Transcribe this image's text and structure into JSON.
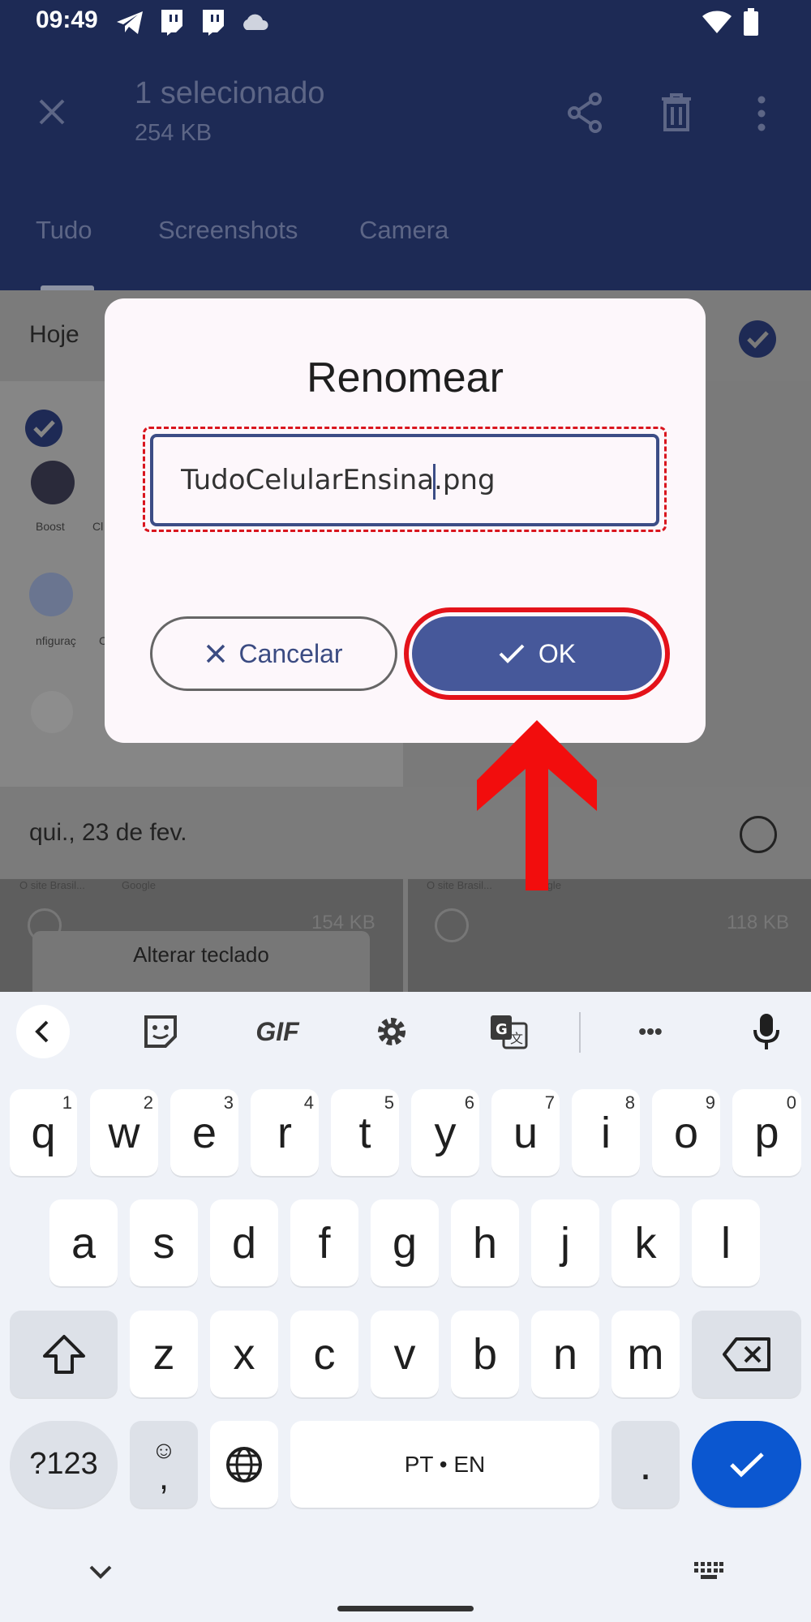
{
  "status_bar": {
    "time": "09:49"
  },
  "app_bar": {
    "title": "1 selecionado",
    "subtitle": "254 KB",
    "tabs": [
      "Tudo",
      "Screenshots",
      "Camera"
    ]
  },
  "background": {
    "section_today": "Hoje",
    "app_labels": [
      "Boost",
      "Cl",
      "nfiguraç",
      "C"
    ],
    "section_date": "qui., 23 de fev.",
    "thumb1_text": [
      "O site Brasil...",
      "Google"
    ],
    "thumb2_text": [
      "O site Brasil...",
      "Google"
    ],
    "thumb1_size": "154 KB",
    "thumb2_size": "118 KB",
    "toast": "Alterar teclado"
  },
  "dialog": {
    "title": "Renomear",
    "input_value": "TudoCelularEnsina.png",
    "cancel_label": "Cancelar",
    "ok_label": "OK"
  },
  "keyboard": {
    "toolbar": [
      "back-icon",
      "sticker-icon",
      "GIF",
      "settings-icon",
      "translate-icon",
      "more-icon",
      "mic-icon"
    ],
    "gif_label": "GIF",
    "more_label": "•••",
    "row1": [
      [
        "q",
        "1"
      ],
      [
        "w",
        "2"
      ],
      [
        "e",
        "3"
      ],
      [
        "r",
        "4"
      ],
      [
        "t",
        "5"
      ],
      [
        "y",
        "6"
      ],
      [
        "u",
        "7"
      ],
      [
        "i",
        "8"
      ],
      [
        "o",
        "9"
      ],
      [
        "p",
        "0"
      ]
    ],
    "row2": [
      "a",
      "s",
      "d",
      "f",
      "g",
      "h",
      "j",
      "k",
      "l"
    ],
    "row3": [
      "z",
      "x",
      "c",
      "v",
      "b",
      "n",
      "m"
    ],
    "symbols_label": "?123",
    "emoji_top": "☺",
    "comma_label": ",",
    "space_label": "PT • EN",
    "period_label": "."
  },
  "colors": {
    "app_bar": "#1d2a55",
    "primary_button": "#46589a",
    "highlight": "#e4121a",
    "enter_key": "#0b57d0"
  }
}
